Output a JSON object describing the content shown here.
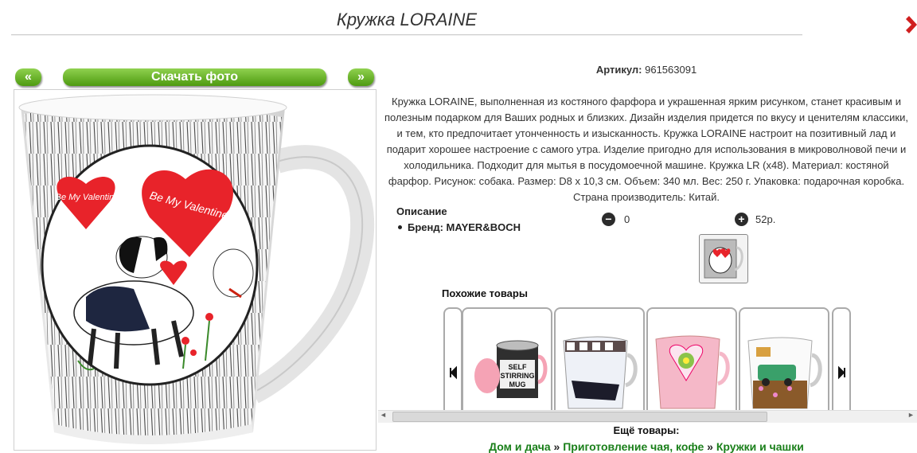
{
  "title": "Кружка LORAINE",
  "nav": {
    "prev": "«",
    "download": "Скачать фото",
    "next": "»"
  },
  "sku": {
    "label": "Артикул:",
    "value": "961563091"
  },
  "description": "Кружка LORAINE, выполненная из костяного фарфора и украшенная ярким рисунком, станет красивым и полезным подарком для Ваших родных и близких. Дизайн изделия придется по вкусу и ценителям классики, и тем, кто предпочитает утонченность и изысканность. Кружка LORAINE настроит на позитивный лад и подарит хорошее настроение с самого утра. Изделие пригодно для использования в микроволновой печи и холодильника. Подходит для мытья в посудомоечной машине. Кружка LR (х48). Материал: костяной фарфор. Рисунок: собака. Размер: D8 x 10,3 см. Объем: 340 мл. Вес: 250 г. Упаковка: подарочная коробка. Страна производитель: Китай.",
  "desc_heading": "Описание",
  "brand": "Бренд: MAYER&BOCH",
  "rating": {
    "minus": "0",
    "plus": "52р."
  },
  "mug_text": {
    "heart_left": "Be My Valentine!",
    "heart_right": "Be My Valentine!"
  },
  "similar_heading": "Похожие товары",
  "cards": [
    {
      "name": "self-stirring-mug",
      "text": "SELF STIRRING MUG"
    },
    {
      "name": "fashion-mug"
    },
    {
      "name": "pink-heart-mug"
    },
    {
      "name": "car-mug"
    }
  ],
  "more_heading": "Ещё товары:",
  "breadcrumb": [
    "Дом и дача",
    "»",
    "Приготовление чая, кофе",
    "»",
    "Кружки и чашки"
  ],
  "colors": {
    "green_button": "#6bb52c",
    "link_green": "#1a7f1a",
    "heart_red": "#e8232a"
  }
}
